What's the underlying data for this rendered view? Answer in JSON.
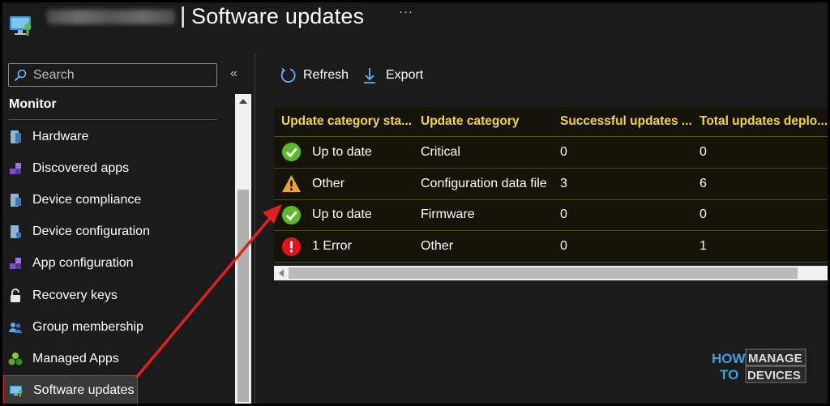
{
  "header": {
    "separator": "|",
    "title": "Software updates",
    "more": "···"
  },
  "sidebar": {
    "search_placeholder": "Search",
    "collapse": "«",
    "section_title": "Monitor",
    "items": [
      {
        "label": "Hardware",
        "icon": "hardware-icon"
      },
      {
        "label": "Discovered apps",
        "icon": "discovered-apps-icon"
      },
      {
        "label": "Device compliance",
        "icon": "device-compliance-icon"
      },
      {
        "label": "Device configuration",
        "icon": "device-configuration-icon"
      },
      {
        "label": "App configuration",
        "icon": "app-configuration-icon"
      },
      {
        "label": "Recovery keys",
        "icon": "lock-icon"
      },
      {
        "label": "Group membership",
        "icon": "group-icon"
      },
      {
        "label": "Managed Apps",
        "icon": "managed-apps-icon"
      },
      {
        "label": "Software updates",
        "icon": "software-updates-icon",
        "selected": true
      }
    ]
  },
  "toolbar": {
    "refresh_label": "Refresh",
    "export_label": "Export"
  },
  "table": {
    "columns": [
      "Update category sta...",
      "Update category",
      "Successful updates ...",
      "Total updates deplo..."
    ],
    "rows": [
      {
        "status": "Up to date",
        "status_icon": "check-icon",
        "category": "Critical",
        "successful": "0",
        "total": "0"
      },
      {
        "status": "Other",
        "status_icon": "warning-icon",
        "category": "Configuration data file",
        "successful": "3",
        "total": "6"
      },
      {
        "status": "Up to date",
        "status_icon": "check-icon",
        "category": "Firmware",
        "successful": "0",
        "total": "0"
      },
      {
        "status": "1 Error",
        "status_icon": "error-icon",
        "category": "Other",
        "successful": "0",
        "total": "1"
      }
    ]
  },
  "watermark": {
    "line1": "HOW",
    "line2": "TO",
    "line3": "MANAGE",
    "line4": "DEVICES"
  },
  "colors": {
    "header_text": "#f5d442",
    "check": "#5cb82a",
    "warning": "#f0a030",
    "error": "#e81123",
    "annotation": "#e02020"
  }
}
